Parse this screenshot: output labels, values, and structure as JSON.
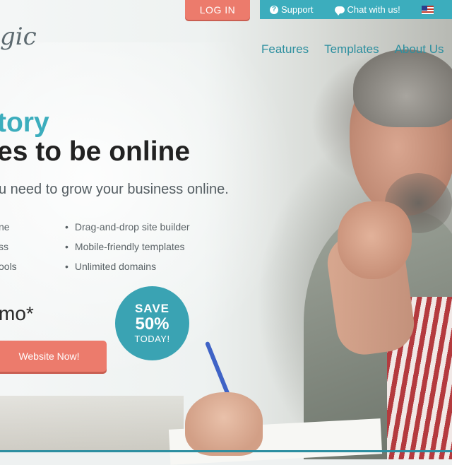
{
  "header": {
    "login_label": "LOG IN",
    "support_label": "Support",
    "chat_label": "Chat with us!",
    "logo_text": "gic"
  },
  "nav": {
    "items": [
      "Features",
      "Templates",
      "About Us"
    ]
  },
  "hero": {
    "title_line1": "tory",
    "title_line2": "es to be online",
    "subtitle": "u need to grow your business online.",
    "features_left": [
      "ne",
      "ss",
      "ools"
    ],
    "features_right": [
      "Drag-and-drop site builder",
      "Mobile-friendly templates",
      "Unlimited domains"
    ],
    "price_text": "mo*",
    "cta_label": "Website Now!"
  },
  "badge": {
    "line1": "SAVE",
    "line2": "50%",
    "line3": "TODAY!"
  },
  "colors": {
    "accent_teal": "#3cadbd",
    "accent_coral": "#ec7b6c"
  }
}
